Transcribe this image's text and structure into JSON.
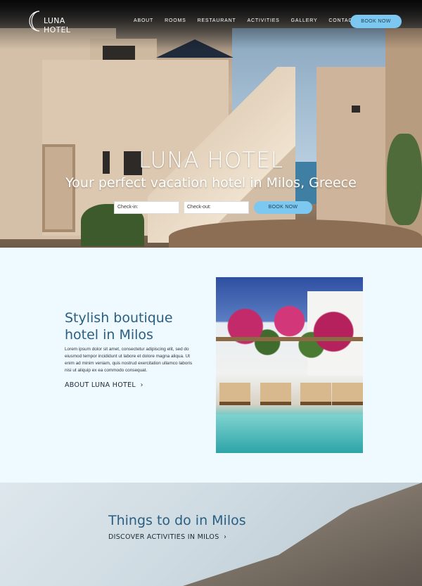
{
  "brand": {
    "name": "LUNA HOTEL"
  },
  "nav": {
    "items": [
      "ABOUT",
      "ROOMS",
      "RESTAURANT",
      "ACTIVITIES",
      "GALLERY",
      "CONTACT"
    ],
    "book_label": "BOOK NOW"
  },
  "hero": {
    "title": "LUNA HOTEL",
    "subtitle": "Your perfect vacation hotel in Milos, Greece",
    "checkin_placeholder": "Check-in:",
    "checkout_placeholder": "Check-out:",
    "book_label": "BOOK NOW"
  },
  "about": {
    "title": "Stylish boutique hotel in Milos",
    "text": "Lorem ipsum dolor sit amet, consectetur adipiscing elit, sed do eiusmod tempor incididunt ut labore et dolore magna aliqua. Ut enim ad minim veniam, quis nostrud exercitation ullamco laboris nisi ut aliquip ex ea commodo consequat.",
    "link_label": "ABOUT LUNA HOTEL",
    "link_icon": "arrow-right-icon"
  },
  "things": {
    "title": "Things to do in Milos",
    "link_label": "DISCOVER ACTIVITIES IN MILOS",
    "link_icon": "arrow-right-icon"
  },
  "colors": {
    "accent": "#7cc8f0",
    "heading": "#2b5f82",
    "page_bg": "#eefaff"
  }
}
